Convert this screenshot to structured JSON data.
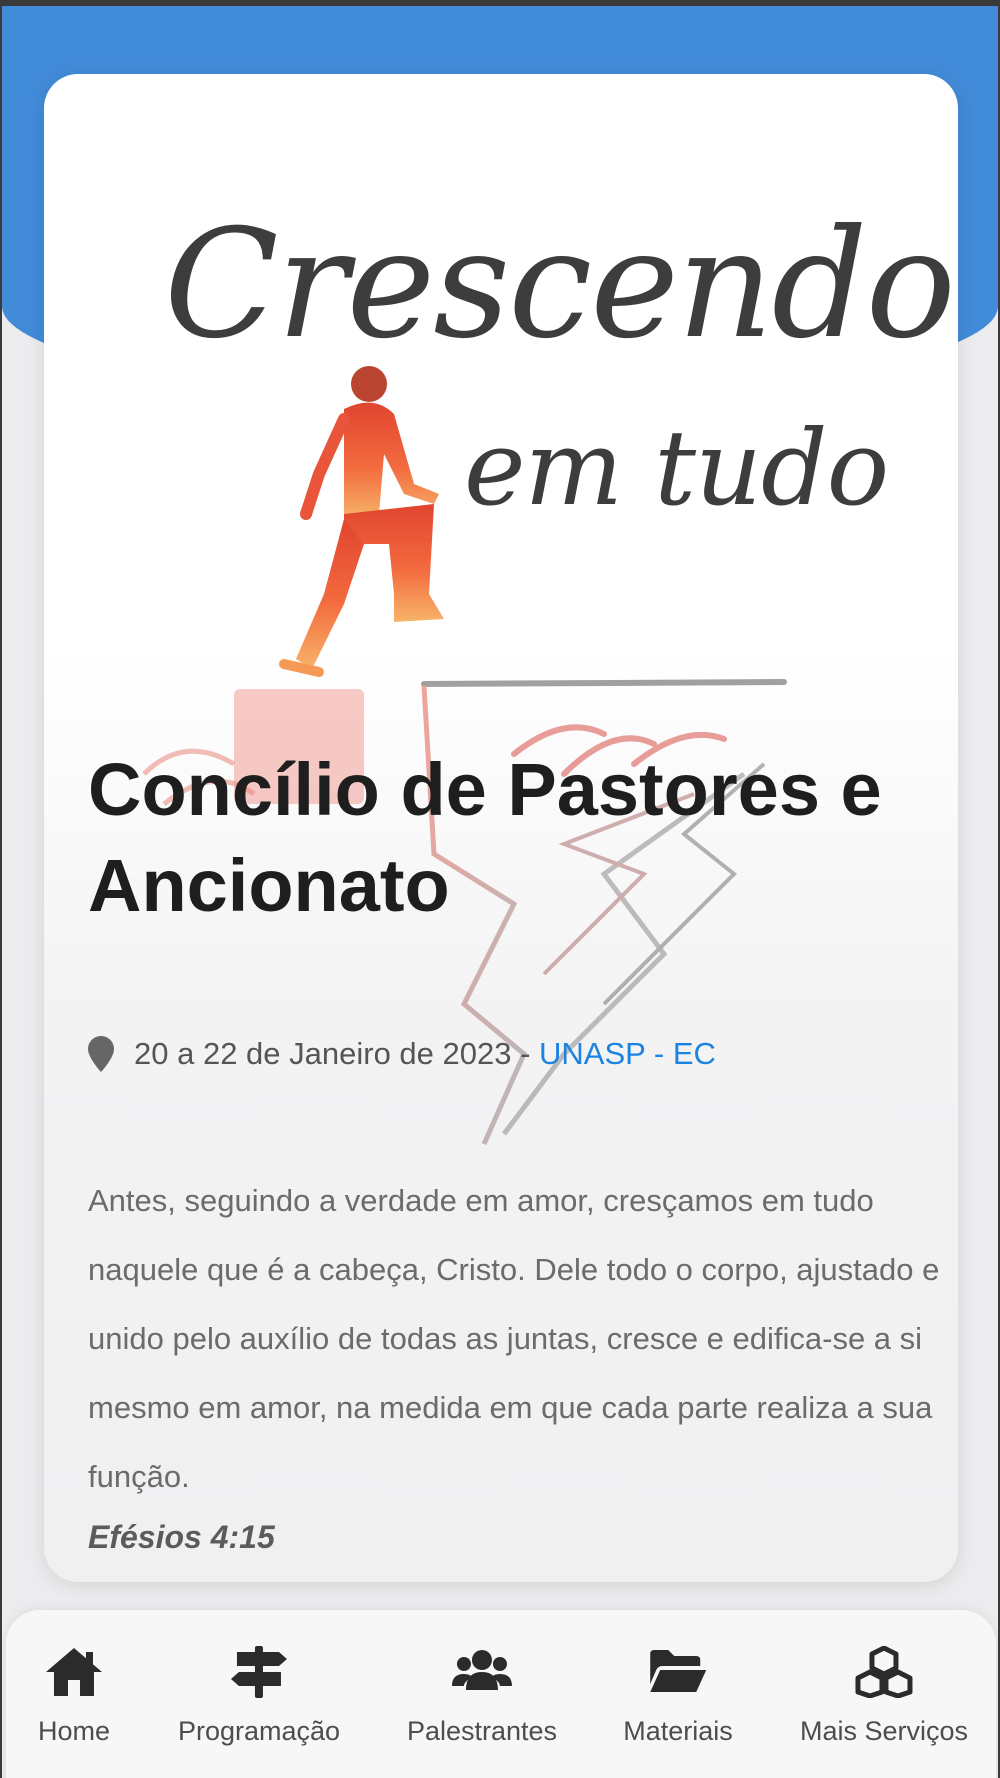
{
  "hero": {
    "logo_line1": "Crescendo",
    "logo_line2": "em tudo"
  },
  "event": {
    "title": "Concílio de Pastores e Ancionato",
    "date_text": "20 a 22 de Janeiro de 2023 - ",
    "location": "UNASP - EC",
    "location_color": "#1c83e3"
  },
  "verse": {
    "text": "Antes, seguindo a verdade em amor, cresçamos em tudo naquele que é a cabeça, Cristo. Dele todo o corpo, ajustado e unido pelo auxílio de todas as juntas, cresce e edifica-se a si mesmo em amor, na medida em que cada parte realiza a sua função.",
    "reference": "Efésios 4:15"
  },
  "nav": [
    {
      "label": "Home",
      "icon": "home-icon"
    },
    {
      "label": "Programação",
      "icon": "signpost-icon"
    },
    {
      "label": "Palestrantes",
      "icon": "users-icon"
    },
    {
      "label": "Materiais",
      "icon": "folder-open-icon"
    },
    {
      "label": "Mais Serviços",
      "icon": "cubes-icon"
    }
  ],
  "colors": {
    "header_blue": "#428bd9",
    "text_dark": "#1e1e1e",
    "icon_dark": "#2b2b2b"
  }
}
